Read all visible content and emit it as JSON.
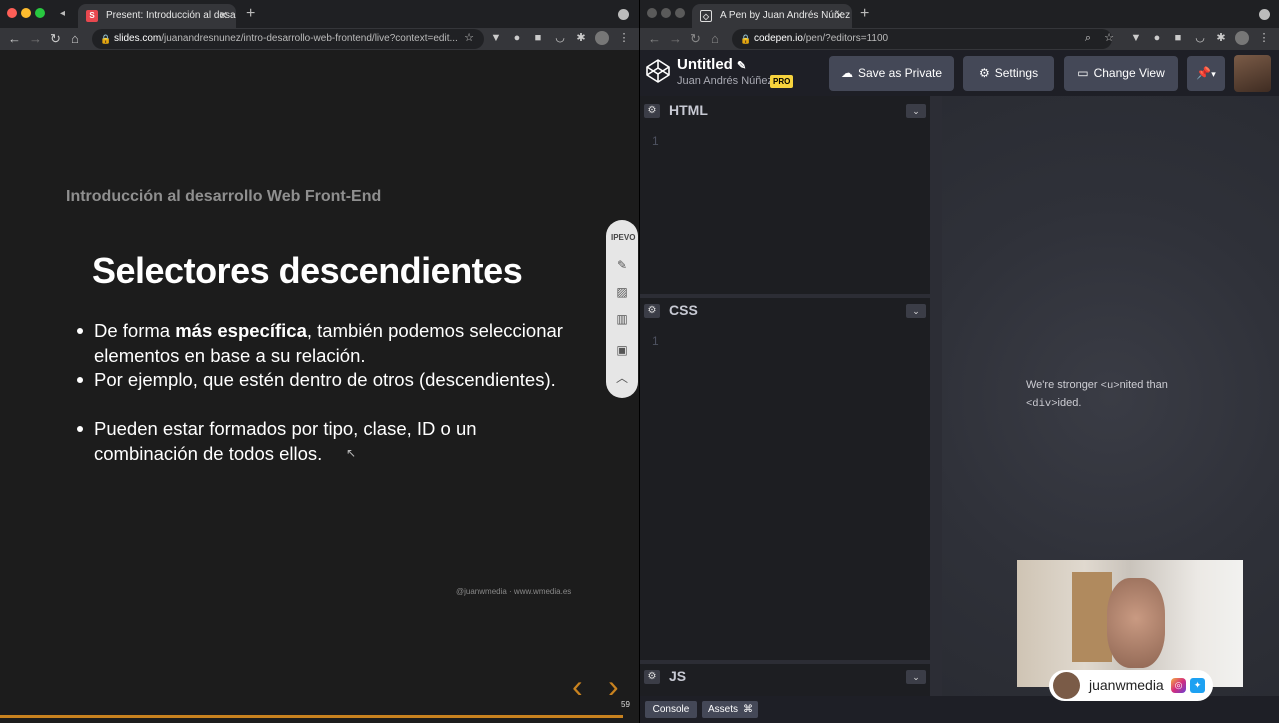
{
  "left_browser": {
    "tab_title": "Present: Introducción al desarr",
    "tab_favicon": "S",
    "url_host": "slides.com",
    "url_path": "/juanandresnunez/intro-desarrollo-web-frontend/live?context=edit..."
  },
  "slide": {
    "subtitle": "Introducción al desarrollo Web Front-End",
    "title": "Selectores descendientes",
    "bullets": [
      {
        "pre": "De forma ",
        "bold": "más específica",
        "post": ", también podemos seleccionar elementos en base a su relación."
      },
      {
        "pre": "Por ejemplo, que estén dentro de otros (descendientes).",
        "bold": "",
        "post": ""
      },
      {
        "pre": "Pueden estar formados por tipo, clase, ID o un combinación de todos ellos.",
        "bold": "",
        "post": ""
      }
    ],
    "footer": "@juanwmedia · www.wmedia.es",
    "page_number": "59",
    "ipevo_label": "IPEVO"
  },
  "right_browser": {
    "tab_title": "A Pen by Juan Andrés Núñez",
    "url_host": "codepen.io",
    "url_path": "/pen/?editors=1100"
  },
  "codepen": {
    "pen_title": "Untitled",
    "author": "Juan Andrés Núñez",
    "pro_badge": "PRO",
    "save_label": "Save as Private",
    "settings_label": "Settings",
    "change_view_label": "Change View",
    "editors": [
      {
        "lang": "HTML",
        "line": "1"
      },
      {
        "lang": "CSS",
        "line": "1"
      },
      {
        "lang": "JS",
        "line": ""
      }
    ],
    "preview_text_a": "We're stronger ",
    "preview_code_a": "<u>",
    "preview_text_b": "nited than ",
    "preview_code_b": "<div>",
    "preview_text_c": "ided.",
    "console_label": "Console",
    "assets_label": "Assets",
    "shortcuts_label": "⌘"
  },
  "webcam": {
    "handle": "juanwmedia"
  },
  "colors": {
    "slide_bg": "#1c1c1c",
    "accent_orange": "#c8821f",
    "pro_yellow": "#f7d33d",
    "codepen_bg": "#1e1f26"
  }
}
